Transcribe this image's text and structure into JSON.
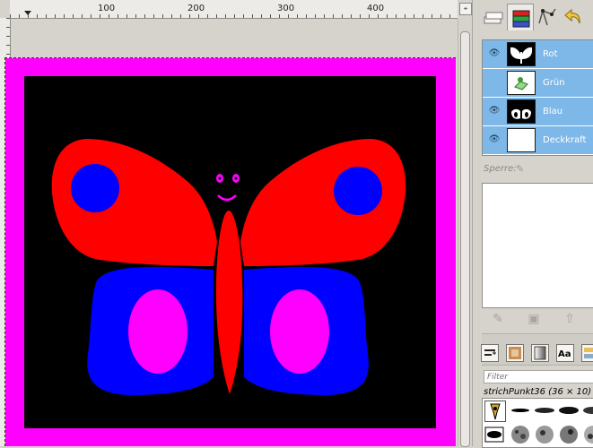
{
  "ruler": {
    "h_labels": [
      "100",
      "200",
      "300",
      "400"
    ],
    "v_labels": []
  },
  "image": {
    "background_color": "#ff00ff",
    "inner_color": "#000000",
    "wing_color": "#ff0000",
    "lower_wing_color": "#0000ff",
    "accent_color": "#ff00ff"
  },
  "layers": [
    {
      "name": "Rot",
      "visible": true
    },
    {
      "name": "Grün",
      "visible": false
    },
    {
      "name": "Blau",
      "visible": true
    },
    {
      "name": "Deckkraft",
      "visible": true
    }
  ],
  "lock": {
    "label": "Sperre:"
  },
  "filter": {
    "placeholder": "Filter"
  },
  "brush": {
    "name": "strichPunkt36 (36 × 10)"
  }
}
